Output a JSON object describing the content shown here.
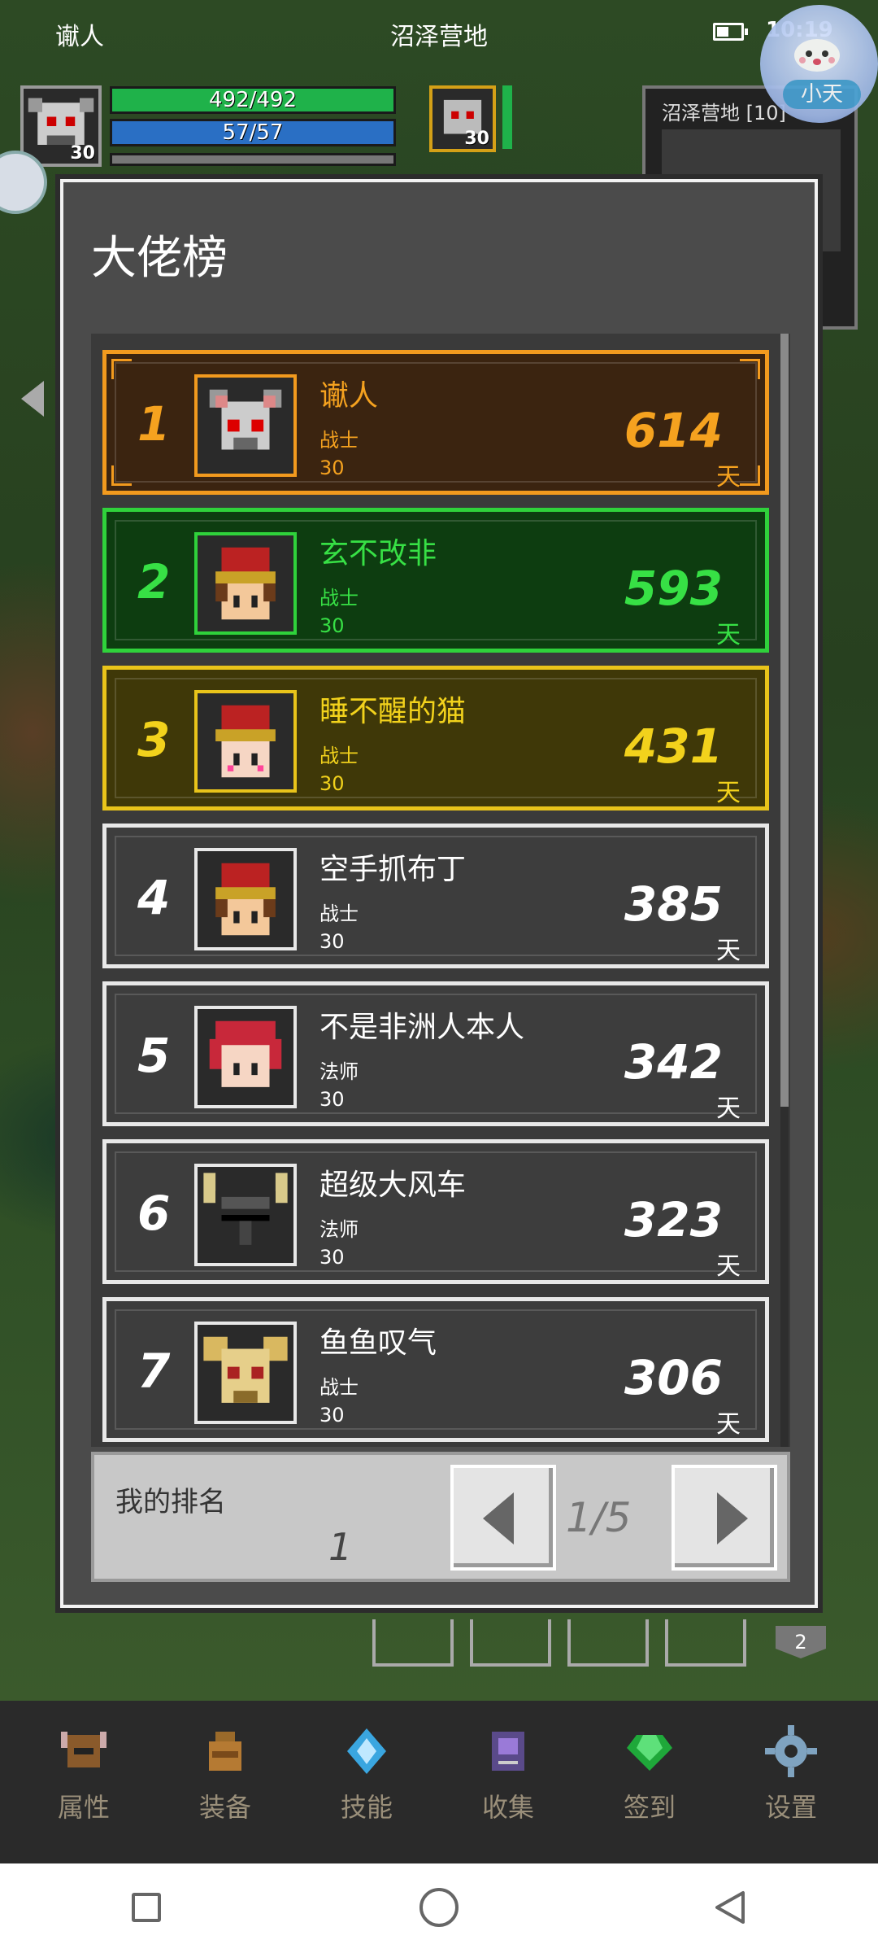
{
  "status_bar": {
    "left_text": "谳人",
    "center_text": "沼泽营地",
    "time": "10:19"
  },
  "assistant": {
    "label": "小天"
  },
  "hud": {
    "hp": "492/492",
    "mp": "57/57",
    "player_level": "30",
    "target_level": "30"
  },
  "minimap": {
    "label": "沼泽营地 [10]"
  },
  "dialog": {
    "title": "大佬榜",
    "rows": [
      {
        "rank": "1",
        "name": "谳人",
        "class": "战士",
        "level": "30",
        "days": "614",
        "unit": "天",
        "avatar": "skull-helmet-avatar"
      },
      {
        "rank": "2",
        "name": "玄不改非",
        "class": "战士",
        "level": "30",
        "days": "593",
        "unit": "天",
        "avatar": "red-hat-warrior-avatar"
      },
      {
        "rank": "3",
        "name": "睡不醒的猫",
        "class": "战士",
        "level": "30",
        "days": "431",
        "unit": "天",
        "avatar": "red-hat-warrior-avatar"
      },
      {
        "rank": "4",
        "name": "空手抓布丁",
        "class": "战士",
        "level": "30",
        "days": "385",
        "unit": "天",
        "avatar": "red-hat-warrior-avatar"
      },
      {
        "rank": "5",
        "name": "不是非洲人本人",
        "class": "法师",
        "level": "30",
        "days": "342",
        "unit": "天",
        "avatar": "red-hair-mage-avatar"
      },
      {
        "rank": "6",
        "name": "超级大风车",
        "class": "法师",
        "level": "30",
        "days": "323",
        "unit": "天",
        "avatar": "horned-helmet-avatar"
      },
      {
        "rank": "7",
        "name": "鱼鱼叹气",
        "class": "战士",
        "level": "30",
        "days": "306",
        "unit": "天",
        "avatar": "golden-winged-helmet-avatar"
      }
    ],
    "my_rank_label": "我的排名",
    "my_rank_value": "1",
    "page_indicator": "1/5"
  },
  "behind_badge": "2",
  "bottom_nav": [
    {
      "label": "属性",
      "icon": "helmet-icon"
    },
    {
      "label": "装备",
      "icon": "bag-icon"
    },
    {
      "label": "技能",
      "icon": "skill-gem-icon"
    },
    {
      "label": "收集",
      "icon": "collection-icon"
    },
    {
      "label": "签到",
      "icon": "emerald-icon"
    },
    {
      "label": "设置",
      "icon": "gear-icon"
    }
  ]
}
